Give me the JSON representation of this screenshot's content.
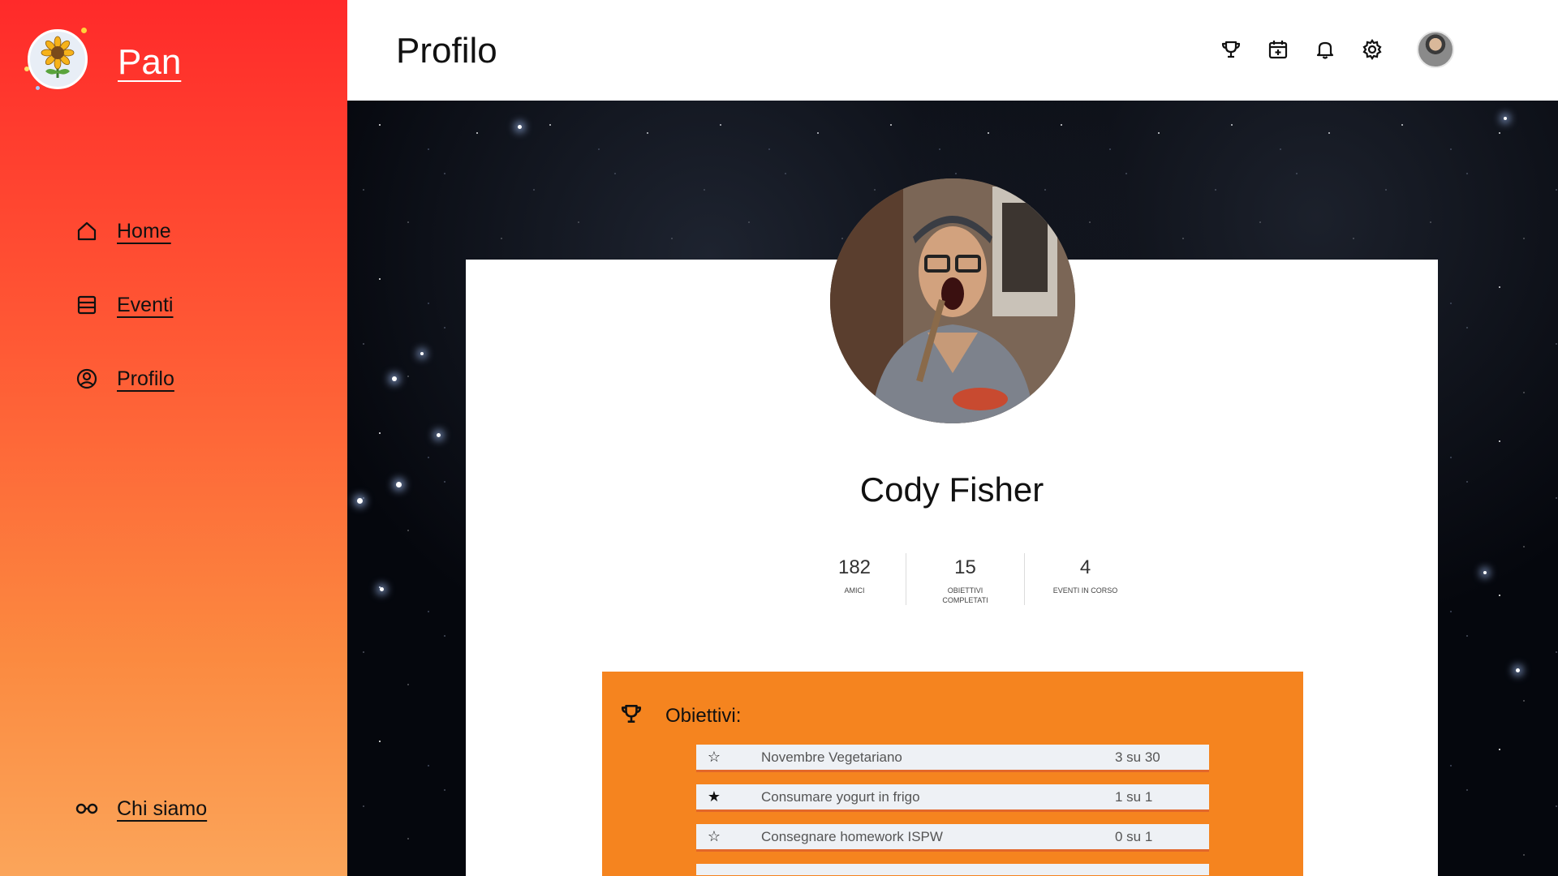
{
  "app": {
    "brand": "Pan",
    "logo_icon": "sunflower-icon"
  },
  "sidebar": {
    "items": [
      {
        "label": "Home",
        "icon": "home-icon"
      },
      {
        "label": "Eventi",
        "icon": "events-icon"
      },
      {
        "label": "Profilo",
        "icon": "user-circle-icon"
      }
    ],
    "footer_item": {
      "label": "Chi siamo",
      "icon": "glasses-icon"
    }
  },
  "header": {
    "title": "Profilo",
    "icons": [
      "trophy-icon",
      "calendar-add-icon",
      "bell-icon",
      "gear-icon",
      "avatar"
    ]
  },
  "profile": {
    "name": "Cody Fisher",
    "stats": [
      {
        "value": "182",
        "label": "AMICI"
      },
      {
        "value": "15",
        "label": "OBIETTIVI COMPLETATI"
      },
      {
        "value": "4",
        "label": "EVENTI IN CORSO"
      }
    ]
  },
  "objectives": {
    "title": "Obiettivi:",
    "items": [
      {
        "star": "☆",
        "name": "Novembre Vegetariano",
        "progress": "3 su 30"
      },
      {
        "star": "★",
        "name": "Consumare yogurt in frigo",
        "progress": "1 su 1"
      },
      {
        "star": "☆",
        "name": "Consegnare homework ISPW",
        "progress": "0 su 1"
      }
    ]
  },
  "colors": {
    "sidebar_top": "#ff2a2a",
    "sidebar_bottom": "#fba55a",
    "objectives_panel": "#f5841f",
    "background": "#05070d"
  }
}
